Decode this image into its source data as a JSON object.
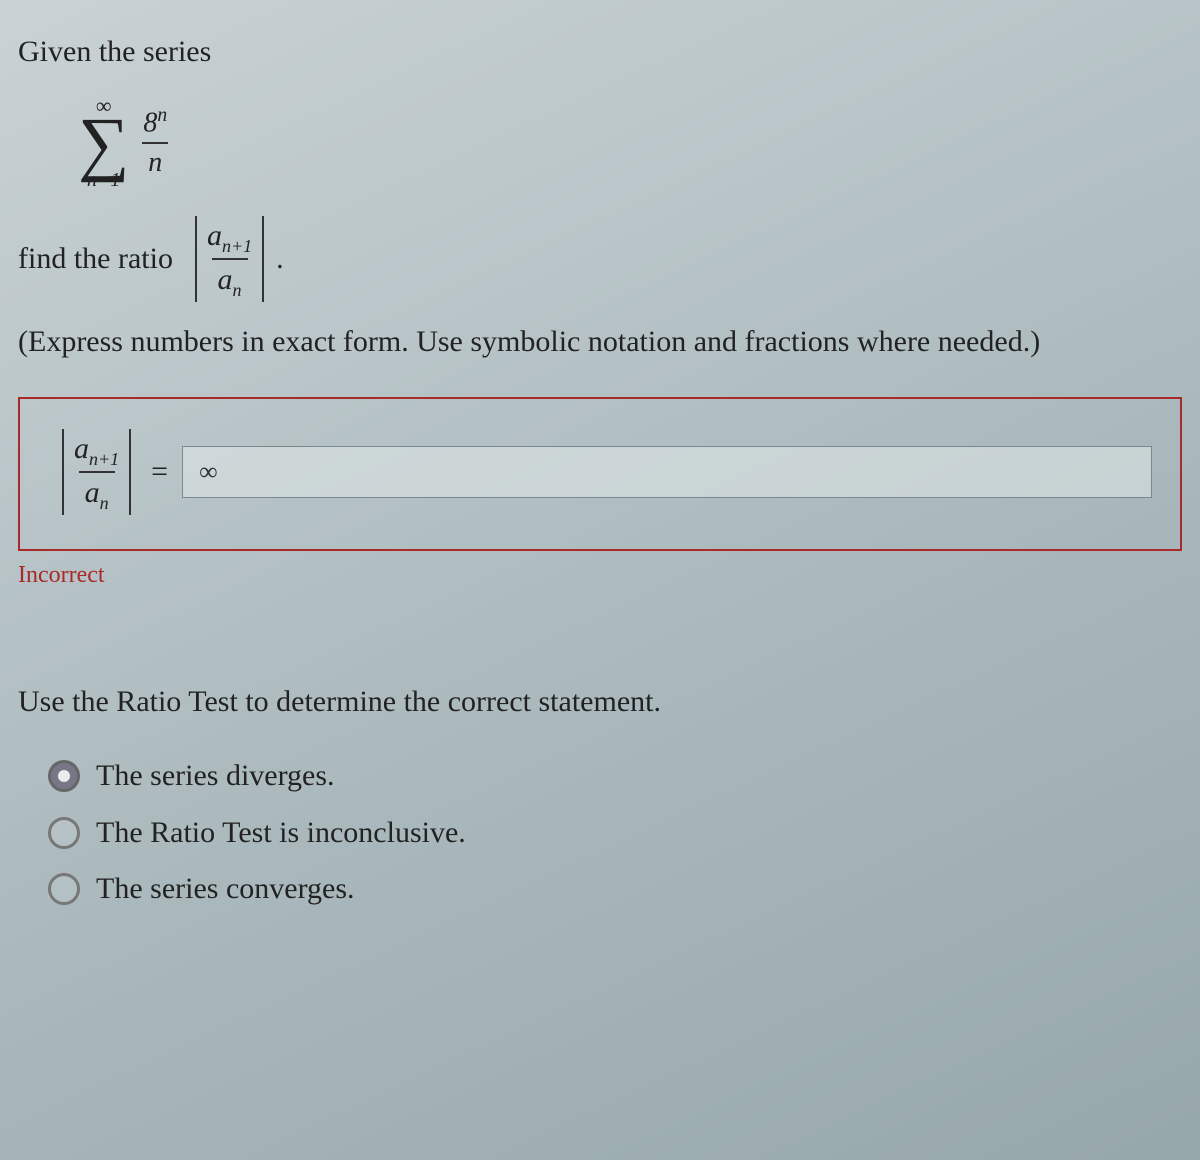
{
  "intro_text": "Given the series",
  "series": {
    "upper": "∞",
    "lower": "n=1",
    "term_num": "8",
    "term_num_exp": "n",
    "term_den": "n"
  },
  "ratio_prompt": "find the ratio",
  "ratio_frac_num": "a",
  "ratio_frac_num_sub": "n+1",
  "ratio_frac_den": "a",
  "ratio_frac_den_sub": "n",
  "period": ".",
  "express_hint": "(Express numbers in exact form. Use symbolic notation and fractions where needed.)",
  "answer_lhs_num": "a",
  "answer_lhs_num_sub": "n+1",
  "answer_lhs_den": "a",
  "answer_lhs_den_sub": "n",
  "equals": "=",
  "answer_value": "∞",
  "incorrect_label": "Incorrect",
  "ratio_test_prompt": "Use the Ratio Test to determine the correct statement.",
  "options": [
    {
      "label": "The series diverges.",
      "selected": true
    },
    {
      "label": "The Ratio Test is inconclusive.",
      "selected": false
    },
    {
      "label": "The series converges.",
      "selected": false
    }
  ]
}
